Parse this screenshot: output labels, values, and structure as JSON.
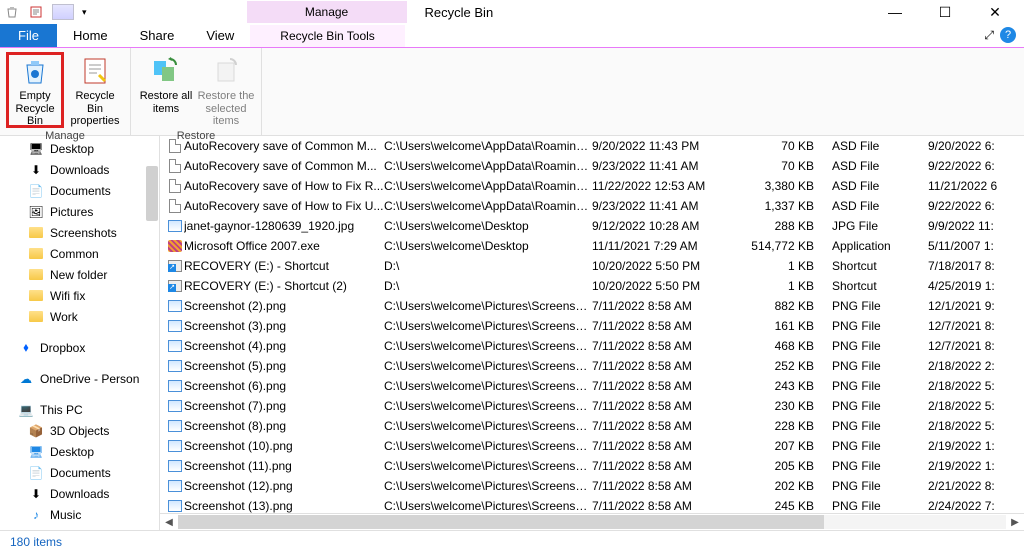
{
  "window": {
    "title": "Recycle Bin",
    "manage_tab": "Manage",
    "min": "—",
    "max": "☐",
    "close": "✕"
  },
  "menu": {
    "file": "File",
    "home": "Home",
    "share": "Share",
    "view": "View",
    "tools": "Recycle Bin Tools",
    "chev": "⤢",
    "help": "?"
  },
  "ribbon": {
    "manage_group": "Manage",
    "restore_group": "Restore",
    "empty": "Empty Recycle Bin",
    "props": "Recycle Bin properties",
    "restore_all": "Restore all items",
    "restore_sel": "Restore the selected items"
  },
  "nav": {
    "desktop": "Desktop",
    "downloads": "Downloads",
    "documents": "Documents",
    "pictures": "Pictures",
    "screenshots": "Screenshots",
    "common": "Common",
    "newfolder": "New folder",
    "wififix": "Wifi fix",
    "work": "Work",
    "dropbox": "Dropbox",
    "onedrive": "OneDrive - Person",
    "thispc": "This PC",
    "objects3d": "3D Objects",
    "pcdesktop": "Desktop",
    "pcdocuments": "Documents",
    "pcdownloads": "Downloads",
    "music": "Music"
  },
  "status": {
    "items": "180 items"
  },
  "files": [
    {
      "icon": "file",
      "name": "AutoRecovery save of Common M...",
      "loc": "C:\\Users\\welcome\\AppData\\Roaming\\M...",
      "date": "9/20/2022 11:43 PM",
      "size": "70 KB",
      "type": "ASD File",
      "del": "9/20/2022 6:"
    },
    {
      "icon": "file",
      "name": "AutoRecovery save of Common M...",
      "loc": "C:\\Users\\welcome\\AppData\\Roaming\\M...",
      "date": "9/23/2022 11:41 AM",
      "size": "70 KB",
      "type": "ASD File",
      "del": "9/22/2022 6:"
    },
    {
      "icon": "file",
      "name": "AutoRecovery save of How to Fix R...",
      "loc": "C:\\Users\\welcome\\AppData\\Roaming\\M...",
      "date": "11/22/2022 12:53 AM",
      "size": "3,380 KB",
      "type": "ASD File",
      "del": "11/21/2022 6"
    },
    {
      "icon": "file",
      "name": "AutoRecovery save of How to Fix U...",
      "loc": "C:\\Users\\welcome\\AppData\\Roaming\\M...",
      "date": "9/23/2022 11:41 AM",
      "size": "1,337 KB",
      "type": "ASD File",
      "del": "9/22/2022 6:"
    },
    {
      "icon": "pic",
      "name": "janet-gaynor-1280639_1920.jpg",
      "loc": "C:\\Users\\welcome\\Desktop",
      "date": "9/12/2022 10:28 AM",
      "size": "288 KB",
      "type": "JPG File",
      "del": "9/9/2022 11:"
    },
    {
      "icon": "exe",
      "name": "Microsoft Office 2007.exe",
      "loc": "C:\\Users\\welcome\\Desktop",
      "date": "11/11/2021 7:29 AM",
      "size": "514,772 KB",
      "type": "Application",
      "del": "5/11/2007 1:"
    },
    {
      "icon": "shcut",
      "name": "RECOVERY (E:) - Shortcut",
      "loc": "D:\\",
      "date": "10/20/2022 5:50 PM",
      "size": "1 KB",
      "type": "Shortcut",
      "del": "7/18/2017 8:"
    },
    {
      "icon": "shcut",
      "name": "RECOVERY (E:) - Shortcut (2)",
      "loc": "D:\\",
      "date": "10/20/2022 5:50 PM",
      "size": "1 KB",
      "type": "Shortcut",
      "del": "4/25/2019 1:"
    },
    {
      "icon": "pic",
      "name": "Screenshot (2).png",
      "loc": "C:\\Users\\welcome\\Pictures\\Screenshots",
      "date": "7/11/2022 8:58 AM",
      "size": "882 KB",
      "type": "PNG File",
      "del": "12/1/2021 9:"
    },
    {
      "icon": "pic",
      "name": "Screenshot (3).png",
      "loc": "C:\\Users\\welcome\\Pictures\\Screenshots",
      "date": "7/11/2022 8:58 AM",
      "size": "161 KB",
      "type": "PNG File",
      "del": "12/7/2021 8:"
    },
    {
      "icon": "pic",
      "name": "Screenshot (4).png",
      "loc": "C:\\Users\\welcome\\Pictures\\Screenshots",
      "date": "7/11/2022 8:58 AM",
      "size": "468 KB",
      "type": "PNG File",
      "del": "12/7/2021 8:"
    },
    {
      "icon": "pic",
      "name": "Screenshot (5).png",
      "loc": "C:\\Users\\welcome\\Pictures\\Screenshots",
      "date": "7/11/2022 8:58 AM",
      "size": "252 KB",
      "type": "PNG File",
      "del": "2/18/2022 2:"
    },
    {
      "icon": "pic",
      "name": "Screenshot (6).png",
      "loc": "C:\\Users\\welcome\\Pictures\\Screenshots",
      "date": "7/11/2022 8:58 AM",
      "size": "243 KB",
      "type": "PNG File",
      "del": "2/18/2022 5:"
    },
    {
      "icon": "pic",
      "name": "Screenshot (7).png",
      "loc": "C:\\Users\\welcome\\Pictures\\Screenshots",
      "date": "7/11/2022 8:58 AM",
      "size": "230 KB",
      "type": "PNG File",
      "del": "2/18/2022 5:"
    },
    {
      "icon": "pic",
      "name": "Screenshot (8).png",
      "loc": "C:\\Users\\welcome\\Pictures\\Screenshots",
      "date": "7/11/2022 8:58 AM",
      "size": "228 KB",
      "type": "PNG File",
      "del": "2/18/2022 5:"
    },
    {
      "icon": "pic",
      "name": "Screenshot (10).png",
      "loc": "C:\\Users\\welcome\\Pictures\\Screenshots",
      "date": "7/11/2022 8:58 AM",
      "size": "207 KB",
      "type": "PNG File",
      "del": "2/19/2022 1:"
    },
    {
      "icon": "pic",
      "name": "Screenshot (11).png",
      "loc": "C:\\Users\\welcome\\Pictures\\Screenshots",
      "date": "7/11/2022 8:58 AM",
      "size": "205 KB",
      "type": "PNG File",
      "del": "2/19/2022 1:"
    },
    {
      "icon": "pic",
      "name": "Screenshot (12).png",
      "loc": "C:\\Users\\welcome\\Pictures\\Screenshots",
      "date": "7/11/2022 8:58 AM",
      "size": "202 KB",
      "type": "PNG File",
      "del": "2/21/2022 8:"
    },
    {
      "icon": "pic",
      "name": "Screenshot (13).png",
      "loc": "C:\\Users\\welcome\\Pictures\\Screenshots",
      "date": "7/11/2022 8:58 AM",
      "size": "245 KB",
      "type": "PNG File",
      "del": "2/24/2022 7:"
    }
  ]
}
